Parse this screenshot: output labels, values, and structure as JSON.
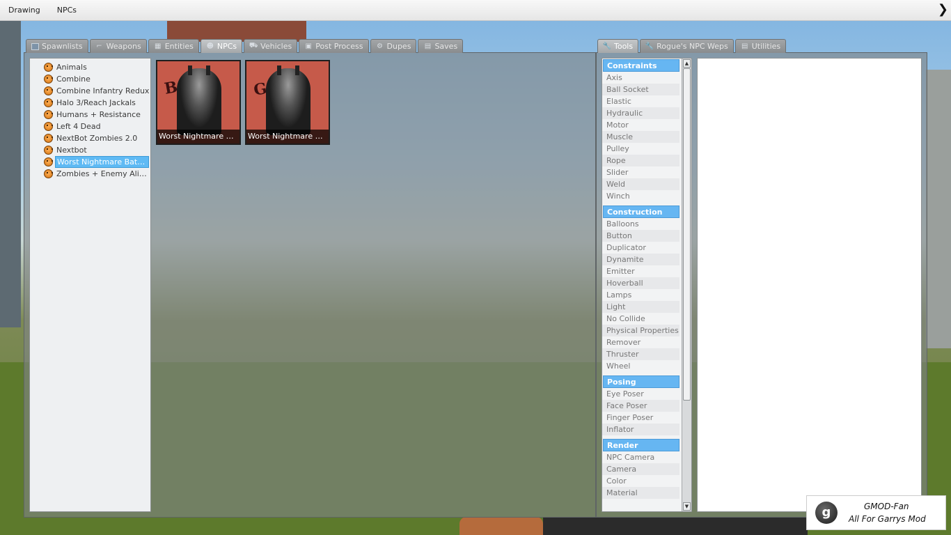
{
  "menubar": {
    "items": [
      "Drawing",
      "NPCs"
    ],
    "collapse_glyph": "❯"
  },
  "left_tabs": [
    {
      "label": "Spawnlists",
      "icon": "grid-icon",
      "active": false
    },
    {
      "label": "Weapons",
      "icon": "gun-icon",
      "active": false
    },
    {
      "label": "Entities",
      "icon": "bricks-icon",
      "active": false
    },
    {
      "label": "NPCs",
      "icon": "monkey-face-icon",
      "active": true
    },
    {
      "label": "Vehicles",
      "icon": "car-icon",
      "active": false
    },
    {
      "label": "Post Process",
      "icon": "picture-icon",
      "active": false
    },
    {
      "label": "Dupes",
      "icon": "gear-icon",
      "active": false
    },
    {
      "label": "Saves",
      "icon": "film-icon",
      "active": false
    }
  ],
  "right_tabs": [
    {
      "label": "Tools",
      "icon": "wrench-icon",
      "active": true
    },
    {
      "label": "Rogue's NPC Weps",
      "icon": "wrench-icon",
      "active": false
    },
    {
      "label": "Utilities",
      "icon": "page-icon",
      "active": false
    }
  ],
  "npc_categories": [
    {
      "label": "Animals",
      "selected": false
    },
    {
      "label": "Combine",
      "selected": false
    },
    {
      "label": "Combine Infantry Redux",
      "selected": false
    },
    {
      "label": "Halo 3/Reach Jackals",
      "selected": false
    },
    {
      "label": "Humans + Resistance",
      "selected": false
    },
    {
      "label": "Left 4 Dead",
      "selected": false
    },
    {
      "label": "NextBot Zombies 2.0",
      "selected": false
    },
    {
      "label": "Nextbot",
      "selected": false
    },
    {
      "label": "Worst Nightmare BatMan...",
      "selected": true
    },
    {
      "label": "Zombies + Enemy Aliens",
      "selected": false
    }
  ],
  "npc_icons": [
    {
      "caption": "Worst Nightmare BatM...",
      "poster_text": "BAD"
    },
    {
      "caption": "Worst Nightmare BatM...",
      "poster_text": "GOOD"
    }
  ],
  "tool_categories": [
    {
      "name": "Constraints",
      "items": [
        "Axis",
        "Ball Socket",
        "Elastic",
        "Hydraulic",
        "Motor",
        "Muscle",
        "Pulley",
        "Rope",
        "Slider",
        "Weld",
        "Winch"
      ]
    },
    {
      "name": "Construction",
      "items": [
        "Balloons",
        "Button",
        "Duplicator",
        "Dynamite",
        "Emitter",
        "Hoverball",
        "Lamps",
        "Light",
        "No Collide",
        "Physical Properties",
        "Remover",
        "Thruster",
        "Wheel"
      ]
    },
    {
      "name": "Posing",
      "items": [
        "Eye Poser",
        "Face Poser",
        "Finger Poser",
        "Inflator"
      ]
    },
    {
      "name": "Render",
      "items": [
        "NPC Camera",
        "Camera",
        "Color",
        "Material"
      ]
    }
  ],
  "scrollbar": {
    "up_glyph": "▲",
    "down_glyph": "▼"
  },
  "watermark": {
    "logo_letter": "g",
    "line1": "GMOD-Fan",
    "line2": "All For Garrys Mod"
  },
  "colors": {
    "selection": "#5fbaf4",
    "category_header": "#66b6f2",
    "panel_frame": "#808486"
  }
}
